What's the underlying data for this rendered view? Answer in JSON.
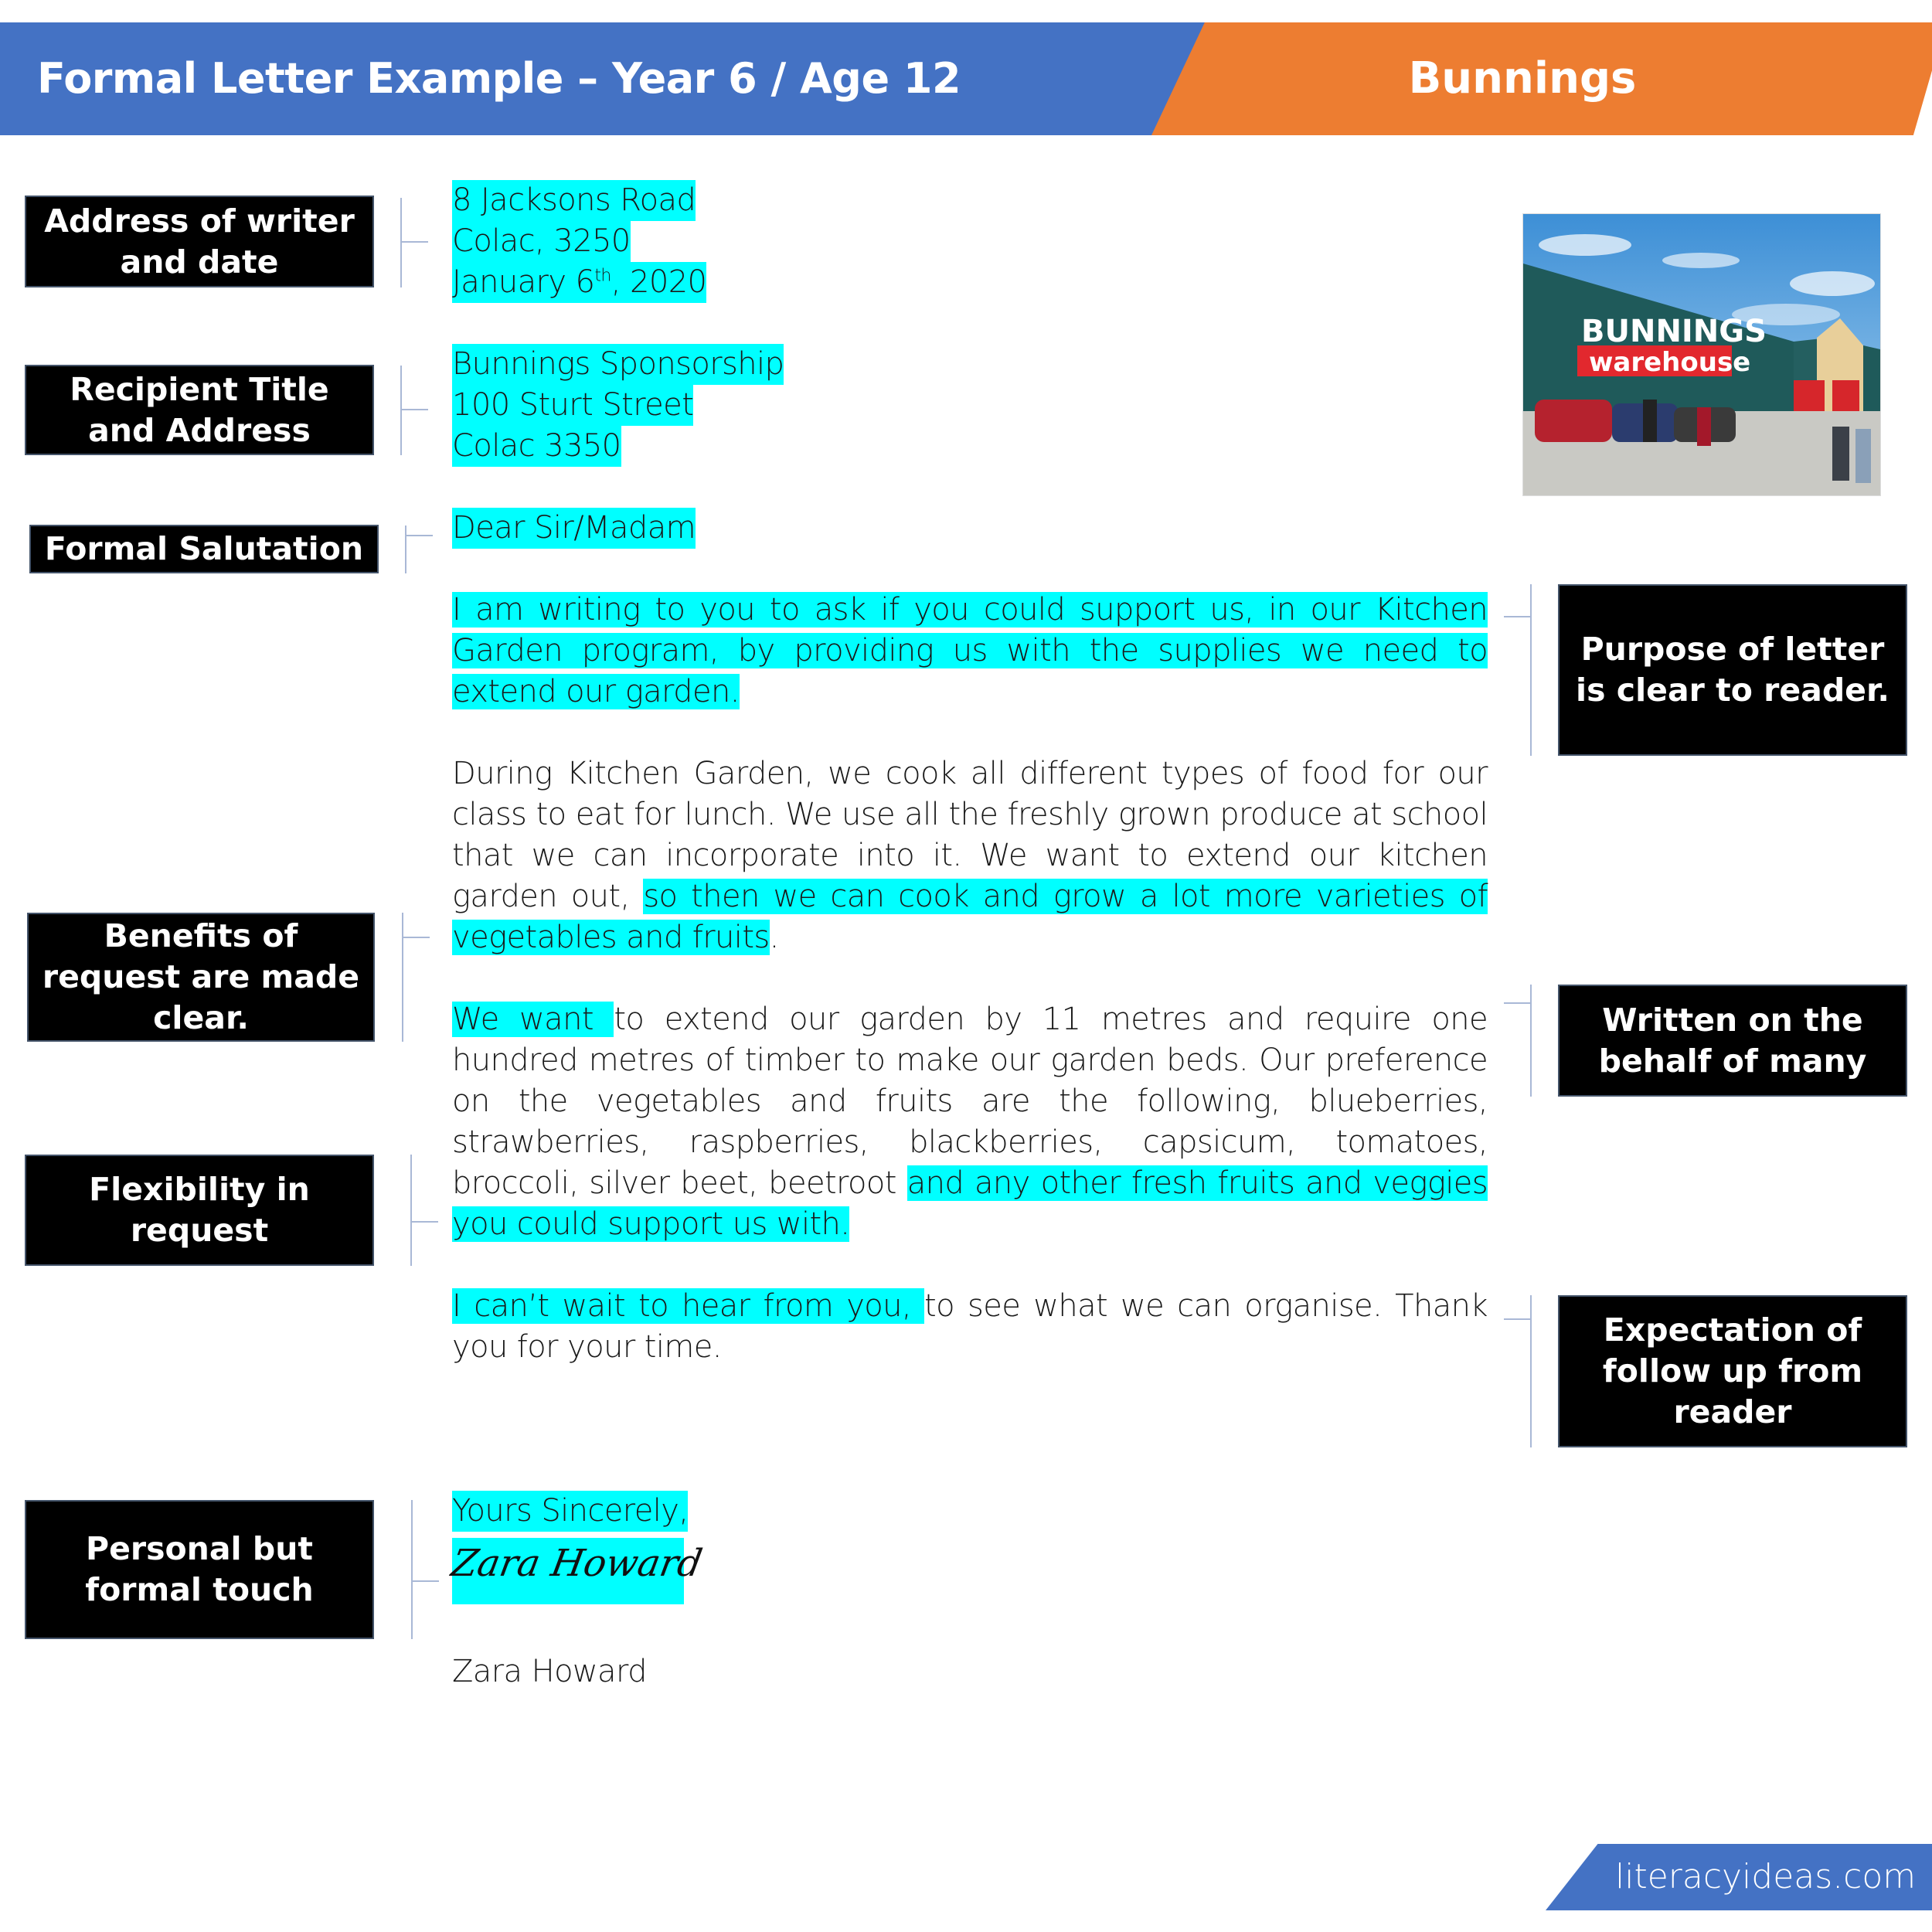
{
  "header": {
    "title": "Formal Letter Example – Year 6 / Age 12",
    "topic": "Bunnings",
    "colors": {
      "title_band": "#4472C4",
      "topic_band": "#ED7D31"
    }
  },
  "annotations": {
    "left": [
      {
        "id": "address-of-writer",
        "label": "Address of writer and date"
      },
      {
        "id": "recipient",
        "label": "Recipient Title and Address"
      },
      {
        "id": "salutation",
        "label": "Formal Salutation"
      },
      {
        "id": "benefits",
        "label": "Benefits of request are made clear."
      },
      {
        "id": "flexibility",
        "label": "Flexibility in request"
      },
      {
        "id": "personal-touch",
        "label": "Personal but formal touch"
      }
    ],
    "right": [
      {
        "id": "purpose",
        "label": "Purpose of letter is clear to reader."
      },
      {
        "id": "on-behalf",
        "label": "Written on the behalf of many"
      },
      {
        "id": "follow-up",
        "label": "Expectation of follow up from reader"
      }
    ]
  },
  "letter": {
    "highlight_color": "#00FFFF",
    "writer_address": [
      "8 Jacksons Road",
      "Colac, 3250"
    ],
    "date": {
      "prefix": "January 6",
      "suffix": "th",
      "year": ", 2020"
    },
    "recipient": [
      "Bunnings Sponsorship",
      "100 Sturt Street",
      "Colac 3350"
    ],
    "salutation": "Dear Sir/Madam",
    "paragraph1": "I am writing to you to ask if you could support us, in our Kitchen Garden program, by providing us with the supplies we need to extend our garden.",
    "paragraph2": {
      "plain": "During Kitchen Garden, we cook all different types of food for our class to eat for lunch. We use all the freshly grown produce at school that we can incorporate into it. We want to extend our kitchen garden out, ",
      "highlight": "so then we can cook and grow a lot more varieties of vegetables and fruits",
      "end": "."
    },
    "paragraph3": {
      "highlight_start": "We want ",
      "plain": "to extend our garden by 11 metres and require one hundred metres of timber to make our garden beds. Our preference on the vegetables and fruits are the following, blueberries, strawberries, raspberries, blackberries, capsicum, tomatoes, broccoli, silver beet, beetroot ",
      "highlight_end": "and any other fresh fruits and veggies you could support us with."
    },
    "paragraph4": {
      "highlight": "I can’t wait to hear from you, ",
      "plain": "to see what we can organise. Thank you for your time."
    },
    "closing": "Yours Sincerely,",
    "signature": "Zara Howard",
    "name": "Zara Howard"
  },
  "photo": {
    "alt": "Bunnings Warehouse store exterior",
    "sign_line1": "BUNNINGS",
    "sign_line2": "warehouse"
  },
  "footer": {
    "site": "literacyideas.com"
  }
}
